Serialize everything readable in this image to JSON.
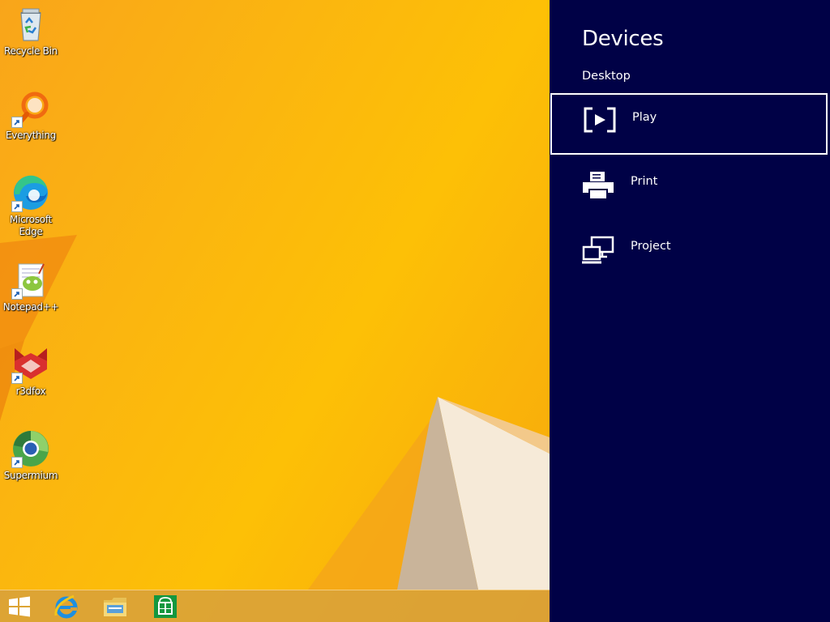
{
  "desktop": {
    "icons": [
      {
        "label": "Recycle Bin",
        "icon": "recycle-bin-icon",
        "shortcut": false
      },
      {
        "label": "Everything",
        "icon": "everything-search-icon",
        "shortcut": true
      },
      {
        "label": "Microsoft Edge",
        "icon": "edge-icon",
        "shortcut": true
      },
      {
        "label": "Notepad++",
        "icon": "notepad-plus-plus-icon",
        "shortcut": true
      },
      {
        "label": "r3dfox",
        "icon": "r3dfox-icon",
        "shortcut": true
      },
      {
        "label": "Supermium",
        "icon": "supermium-icon",
        "shortcut": true
      }
    ]
  },
  "taskbar": {
    "items": [
      {
        "icon": "windows-start-icon"
      },
      {
        "icon": "internet-explorer-icon"
      },
      {
        "icon": "file-explorer-icon"
      },
      {
        "icon": "store-icon"
      }
    ]
  },
  "charm": {
    "title": "Devices",
    "subtitle": "Desktop",
    "items": [
      {
        "label": "Play",
        "icon": "play-device-icon",
        "selected": true
      },
      {
        "label": "Print",
        "icon": "printer-icon",
        "selected": false
      },
      {
        "label": "Project",
        "icon": "project-screen-icon",
        "selected": false
      }
    ]
  },
  "colors": {
    "charm_background": "#000146",
    "wallpaper": "#fbb60f",
    "charm_text": "#ffffff"
  }
}
